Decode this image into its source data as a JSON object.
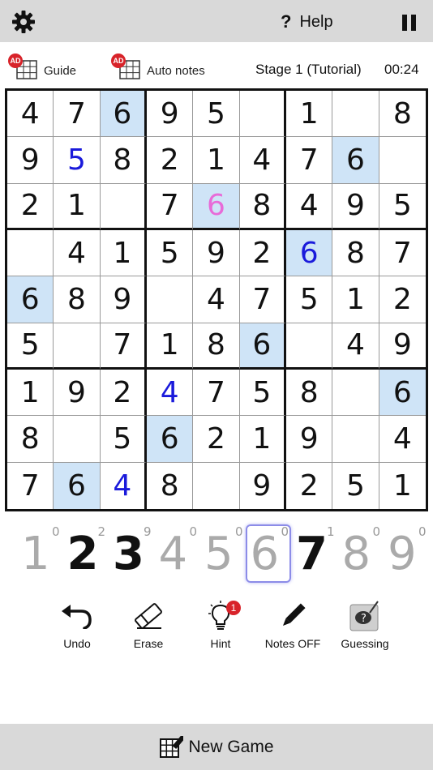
{
  "header": {
    "help_label": "Help"
  },
  "toolbar": {
    "guide_label": "Guide",
    "auto_notes_label": "Auto notes",
    "ad_badge": "AD",
    "stage_label": "Stage 1 (Tutorial)",
    "timer": "00:24"
  },
  "board": {
    "cells": [
      [
        {
          "v": "4"
        },
        {
          "v": "7"
        },
        {
          "v": "6",
          "hl": true
        },
        {
          "v": "9"
        },
        {
          "v": "5"
        },
        {
          "v": ""
        },
        {
          "v": "1"
        },
        {
          "v": ""
        },
        {
          "v": "8"
        }
      ],
      [
        {
          "v": "9"
        },
        {
          "v": "5",
          "color": "blue"
        },
        {
          "v": "8"
        },
        {
          "v": "2"
        },
        {
          "v": "1"
        },
        {
          "v": "4"
        },
        {
          "v": "7"
        },
        {
          "v": "6",
          "hl": true
        },
        {
          "v": ""
        }
      ],
      [
        {
          "v": "2"
        },
        {
          "v": "1"
        },
        {
          "v": ""
        },
        {
          "v": "7"
        },
        {
          "v": "6",
          "hl": true,
          "color": "pink"
        },
        {
          "v": "8"
        },
        {
          "v": "4"
        },
        {
          "v": "9"
        },
        {
          "v": "5"
        }
      ],
      [
        {
          "v": ""
        },
        {
          "v": "4"
        },
        {
          "v": "1"
        },
        {
          "v": "5"
        },
        {
          "v": "9"
        },
        {
          "v": "2"
        },
        {
          "v": "6",
          "hl": true,
          "color": "blue"
        },
        {
          "v": "8"
        },
        {
          "v": "7"
        }
      ],
      [
        {
          "v": "6",
          "hl": true
        },
        {
          "v": "8"
        },
        {
          "v": "9"
        },
        {
          "v": ""
        },
        {
          "v": "4"
        },
        {
          "v": "7"
        },
        {
          "v": "5"
        },
        {
          "v": "1"
        },
        {
          "v": "2"
        }
      ],
      [
        {
          "v": "5"
        },
        {
          "v": ""
        },
        {
          "v": "7"
        },
        {
          "v": "1"
        },
        {
          "v": "8"
        },
        {
          "v": "6",
          "hl": true
        },
        {
          "v": ""
        },
        {
          "v": "4"
        },
        {
          "v": "9"
        }
      ],
      [
        {
          "v": "1"
        },
        {
          "v": "9"
        },
        {
          "v": "2"
        },
        {
          "v": "4",
          "color": "blue"
        },
        {
          "v": "7"
        },
        {
          "v": "5"
        },
        {
          "v": "8"
        },
        {
          "v": ""
        },
        {
          "v": "6",
          "hl": true
        }
      ],
      [
        {
          "v": "8"
        },
        {
          "v": ""
        },
        {
          "v": "5"
        },
        {
          "v": "6",
          "hl": true
        },
        {
          "v": "2"
        },
        {
          "v": "1"
        },
        {
          "v": "9"
        },
        {
          "v": ""
        },
        {
          "v": "4"
        }
      ],
      [
        {
          "v": "7"
        },
        {
          "v": "6",
          "hl": true
        },
        {
          "v": "4",
          "color": "blue"
        },
        {
          "v": "8"
        },
        {
          "v": ""
        },
        {
          "v": "9"
        },
        {
          "v": "2"
        },
        {
          "v": "5"
        },
        {
          "v": "1"
        }
      ]
    ],
    "highlight_color": "#cfe4f7",
    "blue_color": "#1a1adb",
    "pink_color": "#e86bd8"
  },
  "numpad": [
    {
      "digit": "1",
      "count": "0",
      "state": "done"
    },
    {
      "digit": "2",
      "count": "2",
      "state": "active"
    },
    {
      "digit": "3",
      "count": "9",
      "state": "active"
    },
    {
      "digit": "4",
      "count": "0",
      "state": "done"
    },
    {
      "digit": "5",
      "count": "0",
      "state": "done"
    },
    {
      "digit": "6",
      "count": "0",
      "state": "selected"
    },
    {
      "digit": "7",
      "count": "1",
      "state": "active"
    },
    {
      "digit": "8",
      "count": "0",
      "state": "done"
    },
    {
      "digit": "9",
      "count": "0",
      "state": "done"
    }
  ],
  "actions": {
    "undo_label": "Undo",
    "erase_label": "Erase",
    "hint_label": "Hint",
    "hint_badge": "1",
    "notes_label": "Notes OFF",
    "guessing_label": "Guessing"
  },
  "footer": {
    "new_game_label": "New Game"
  },
  "icons": {
    "settings": "gear-icon",
    "help": "question-icon",
    "pause": "pause-icon",
    "undo": "undo-icon",
    "erase": "eraser-icon",
    "hint": "lightbulb-icon",
    "notes": "pencil-icon",
    "guessing": "guessing-icon",
    "new_game": "new-game-icon"
  }
}
